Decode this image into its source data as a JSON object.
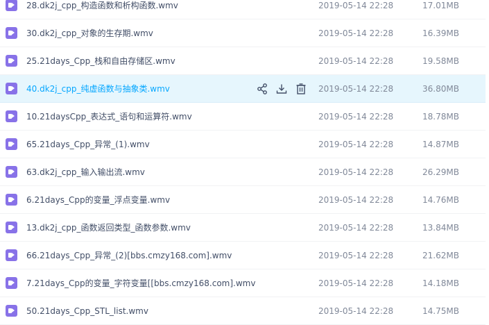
{
  "colors": {
    "row_hover_bg": "#e6f6fd",
    "hover_text": "#06a7ff",
    "video_icon": "#8872e8",
    "name_text": "#424e67",
    "meta_text": "#818999"
  },
  "hover_actions": {
    "share_icon": "share-icon",
    "download_icon": "download-icon",
    "delete_icon": "trash-icon"
  },
  "files": [
    {
      "name": "28.dk2j_cpp_构造函数和析构函数.wmv",
      "date": "2019-05-14 22:28",
      "size": "17.01MB",
      "icon": "video-file-icon"
    },
    {
      "name": "30.dk2j_cpp_对象的生存期.wmv",
      "date": "2019-05-14 22:28",
      "size": "16.39MB",
      "icon": "video-file-icon"
    },
    {
      "name": "25.21days_Cpp_栈和自由存储区.wmv",
      "date": "2019-05-14 22:28",
      "size": "19.58MB",
      "icon": "video-file-icon"
    },
    {
      "name": "40.dk2j_cpp_纯虚函数与抽象类.wmv",
      "date": "2019-05-14 22:28",
      "size": "36.80MB",
      "icon": "video-file-icon",
      "hovered": true
    },
    {
      "name": "10.21daysCpp_表达式_语句和运算符.wmv",
      "date": "2019-05-14 22:28",
      "size": "18.78MB",
      "icon": "video-file-icon"
    },
    {
      "name": "65.21days_Cpp_异常_(1).wmv",
      "date": "2019-05-14 22:28",
      "size": "14.87MB",
      "icon": "video-file-icon"
    },
    {
      "name": "63.dk2j_cpp_输入输出流.wmv",
      "date": "2019-05-14 22:28",
      "size": "26.29MB",
      "icon": "video-file-icon"
    },
    {
      "name": "6.21days_Cpp的变量_浮点变量.wmv",
      "date": "2019-05-14 22:28",
      "size": "14.76MB",
      "icon": "video-file-icon"
    },
    {
      "name": "13.dk2j_cpp_函数返回类型_函数参数.wmv",
      "date": "2019-05-14 22:28",
      "size": "13.84MB",
      "icon": "video-file-icon"
    },
    {
      "name": "66.21days_Cpp_异常_(2)[bbs.cmzy168.com].wmv",
      "date": "2019-05-14 22:28",
      "size": "21.62MB",
      "icon": "video-file-icon"
    },
    {
      "name": "7.21days_Cpp的变量_字符变量[[bbs.cmzy168.com].wmv",
      "date": "2019-05-14 22:28",
      "size": "14.18MB",
      "icon": "video-file-icon"
    },
    {
      "name": "50.21days_Cpp_STL_list.wmv",
      "date": "2019-05-14 22:28",
      "size": "14.75MB",
      "icon": "video-file-icon"
    }
  ]
}
